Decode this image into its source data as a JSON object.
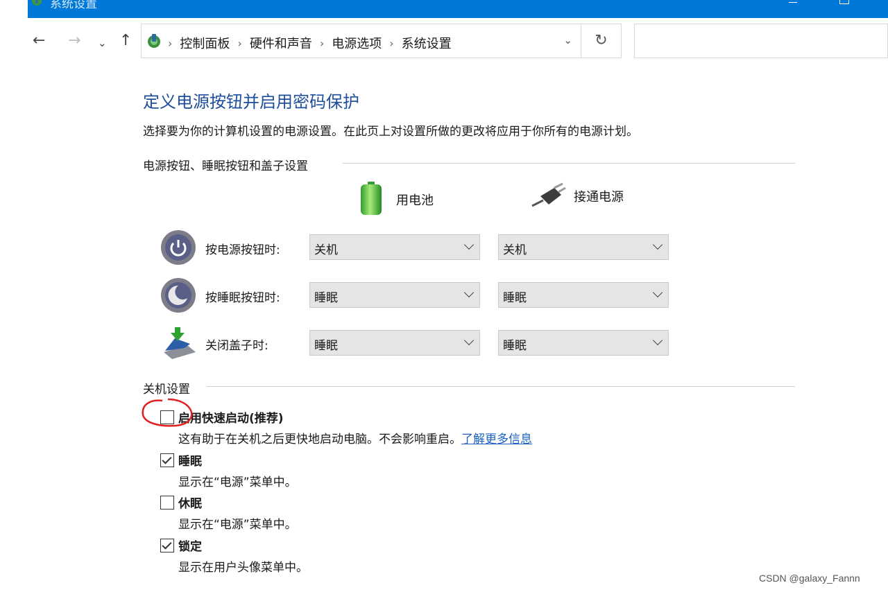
{
  "window": {
    "title": "系统设置"
  },
  "nav": {
    "back_glyph": "←",
    "forward_glyph": "→",
    "recent_glyph": "⌄",
    "up_glyph": "↑",
    "refresh_glyph": "↻",
    "breadcrumbs": [
      "控制面板",
      "硬件和声音",
      "电源选项",
      "系统设置"
    ],
    "separator": "›",
    "search_placeholder": ""
  },
  "page": {
    "title": "定义电源按钮并启用密码保护",
    "description": "选择要为你的计算机设置的电源设置。在此页上对设置所做的更改将应用于你所有的电源计划。"
  },
  "buttons_section": {
    "heading": "电源按钮、睡眠按钮和盖子设置",
    "col_battery": "用电池",
    "col_plugged": "接通电源",
    "rows": [
      {
        "label": "按电源按钮时:",
        "battery": "关机",
        "plugged": "关机",
        "icon": "power-button-icon"
      },
      {
        "label": "按睡眠按钮时:",
        "battery": "睡眠",
        "plugged": "睡眠",
        "icon": "sleep-button-icon"
      },
      {
        "label": "关闭盖子时:",
        "battery": "睡眠",
        "plugged": "睡眠",
        "icon": "laptop-lid-icon"
      }
    ]
  },
  "shutdown_section": {
    "heading": "关机设置",
    "items": [
      {
        "title": "启用快速启动(推荐)",
        "checked": false,
        "desc": "这有助于在关机之后更快地启动电脑。不会影响重启。",
        "link": "了解更多信息"
      },
      {
        "title": "睡眠",
        "checked": true,
        "desc": "显示在“电源”菜单中。"
      },
      {
        "title": "休眠",
        "checked": false,
        "desc": "显示在“电源”菜单中。"
      },
      {
        "title": "锁定",
        "checked": true,
        "desc": "显示在用户头像菜单中。"
      }
    ]
  },
  "watermark": "CSDN @galaxy_Fannn",
  "colors": {
    "titlebar": "#0078d7",
    "title_blue": "#1e4e9c",
    "link": "#1b62c4",
    "annotation": "#e02020"
  }
}
